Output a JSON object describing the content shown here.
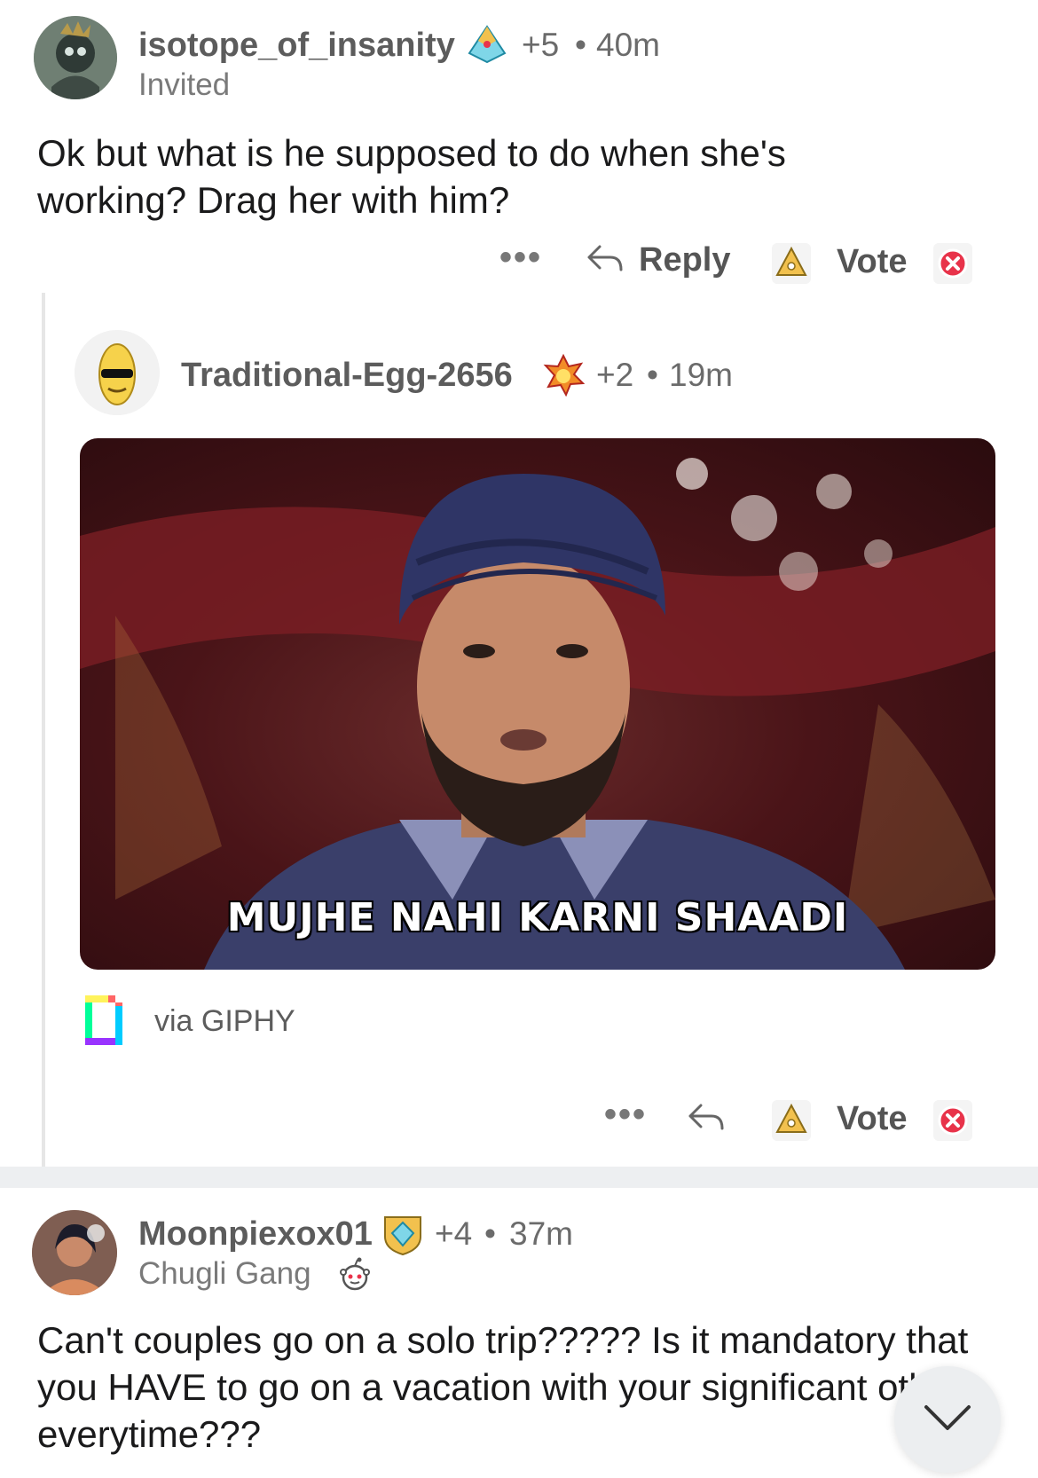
{
  "comments": [
    {
      "username": "isotope_of_insanity",
      "score": "+5",
      "separator": "•",
      "time": "40m",
      "flair": "Invited",
      "body": "Ok but what is he supposed to do when she's working? Drag her with him?",
      "actions": {
        "more": "•••",
        "reply": "Reply",
        "vote": "Vote"
      }
    },
    {
      "username": "Traditional-Egg-2656",
      "score": "+2",
      "separator": "•",
      "time": "19m",
      "gif_caption": "MUJHE NAHI KARNI SHAADI",
      "gif_source": "via GIPHY",
      "actions": {
        "more": "•••",
        "vote": "Vote"
      }
    },
    {
      "username": "Moonpiexox01",
      "score": "+4",
      "separator": "•",
      "time": "37m",
      "flair": "Chugli Gang",
      "body": "Can't couples go on a solo trip????? Is it mandatory that you HAVE to go on a vacation with your significant other everytime???"
    }
  ],
  "icons": {
    "reply": "reply-arrow-icon",
    "vote": "upvote-award-icon",
    "close": "close-x-icon",
    "scroll": "chevron-down-icon"
  },
  "colors": {
    "accent_red": "#e8334a",
    "meta_gray": "#6b6b6b",
    "divider": "#edeff1"
  }
}
